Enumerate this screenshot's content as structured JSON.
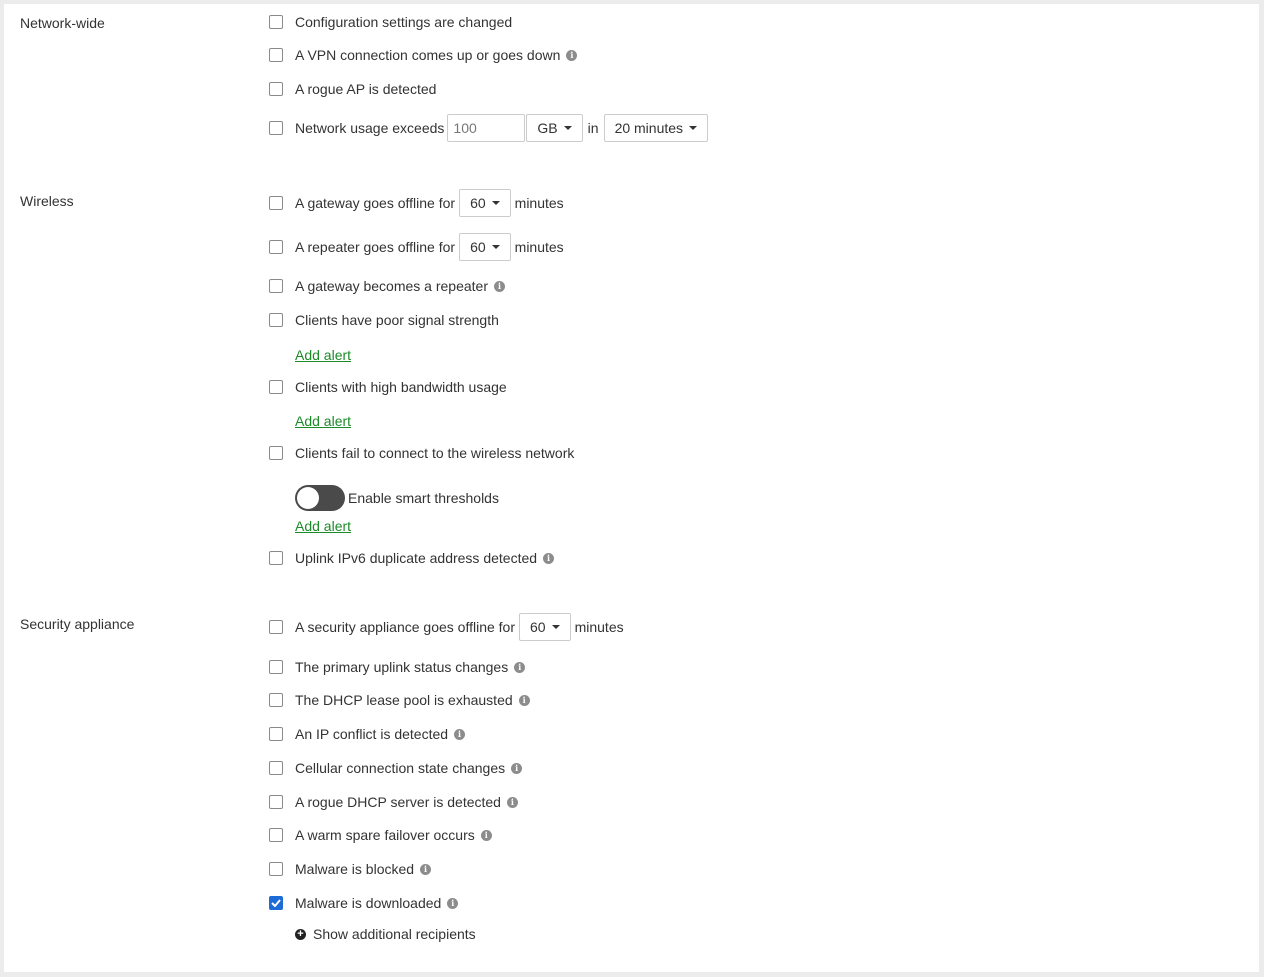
{
  "sections": {
    "network_wide": "Network-wide",
    "wireless": "Wireless",
    "security_appliance": "Security appliance"
  },
  "network_wide": {
    "config_changed": "Configuration settings are changed",
    "vpn": "A VPN connection comes up or goes down",
    "rogue_ap": "A rogue AP is detected",
    "usage_label": "Network usage exceeds",
    "usage_value": "100",
    "usage_unit": "GB",
    "usage_in": "in",
    "usage_period": "20 minutes"
  },
  "wireless": {
    "gateway_offline_label": "A gateway goes offline for",
    "gateway_offline_value": "60",
    "gateway_offline_unit": "minutes",
    "repeater_offline_label": "A repeater goes offline for",
    "repeater_offline_value": "60",
    "repeater_offline_unit": "minutes",
    "gateway_repeater": "A gateway becomes a repeater",
    "poor_signal": "Clients have poor signal strength",
    "add_alert_1": "Add alert",
    "high_bandwidth": "Clients with high bandwidth usage",
    "add_alert_2": "Add alert",
    "fail_connect": "Clients fail to connect to the wireless network",
    "smart_thresholds": "Enable smart thresholds",
    "add_alert_3": "Add alert",
    "ipv6_duplicate": "Uplink IPv6 duplicate address detected"
  },
  "security": {
    "appliance_offline_label": "A security appliance goes offline for",
    "appliance_offline_value": "60",
    "appliance_offline_unit": "minutes",
    "primary_uplink": "The primary uplink status changes",
    "dhcp_exhausted": "The DHCP lease pool is exhausted",
    "ip_conflict": "An IP conflict is detected",
    "cellular_state": "Cellular connection state changes",
    "rogue_dhcp": "A rogue DHCP server is detected",
    "warm_spare": "A warm spare failover occurs",
    "malware_blocked": "Malware is blocked",
    "malware_downloaded": "Malware is downloaded",
    "show_recipients": "Show additional recipients"
  },
  "icons": {
    "info": "info-icon",
    "plus": "plus-circle-icon"
  },
  "colors": {
    "link": "#1c8a28",
    "checkbox_checked": "#1c6bd6"
  }
}
